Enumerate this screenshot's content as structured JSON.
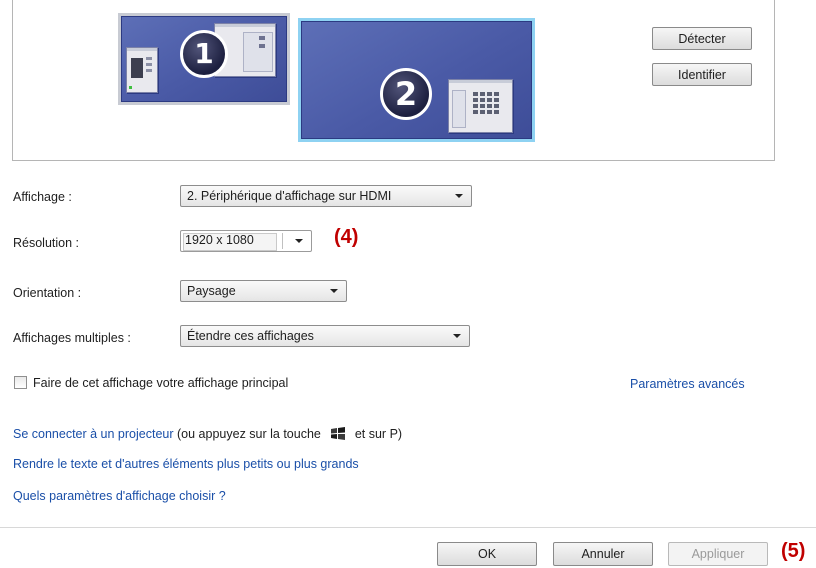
{
  "monitors": [
    {
      "number": "1"
    },
    {
      "number": "2"
    }
  ],
  "buttons": {
    "detect": "Détecter",
    "identify": "Identifier"
  },
  "settings": {
    "display": {
      "label": "Affichage :",
      "value": "2. Périphérique d'affichage sur HDMI"
    },
    "resolution": {
      "label": "Résolution :",
      "value": "1920 x 1080"
    },
    "orientation": {
      "label": "Orientation :",
      "value": "Paysage"
    },
    "multiple_displays": {
      "label": "Affichages multiples :",
      "value": "Étendre ces affichages"
    }
  },
  "annotations": {
    "step4": "(4)",
    "step5": "(5)"
  },
  "primary_checkbox": {
    "label": "Faire de cet affichage votre affichage principal",
    "checked": false
  },
  "advanced_link": "Paramètres avancés",
  "projector": {
    "link": "Se connecter à un projecteur",
    "text_before_icon": "(ou appuyez sur la touche",
    "icon": "windows-logo-icon",
    "text_after_icon": "et sur P)"
  },
  "links": {
    "text_size": "Rendre le texte et d'autres éléments plus petits ou plus grands",
    "which_settings": "Quels paramètres d'affichage choisir ?"
  },
  "footer": {
    "ok": "OK",
    "cancel": "Annuler",
    "apply": "Appliquer"
  },
  "colors": {
    "monitor_fill": "#4a5aa6",
    "selected_outline": "#8ed2f2",
    "link": "#1a4fa8",
    "annotation": "#c00000"
  }
}
